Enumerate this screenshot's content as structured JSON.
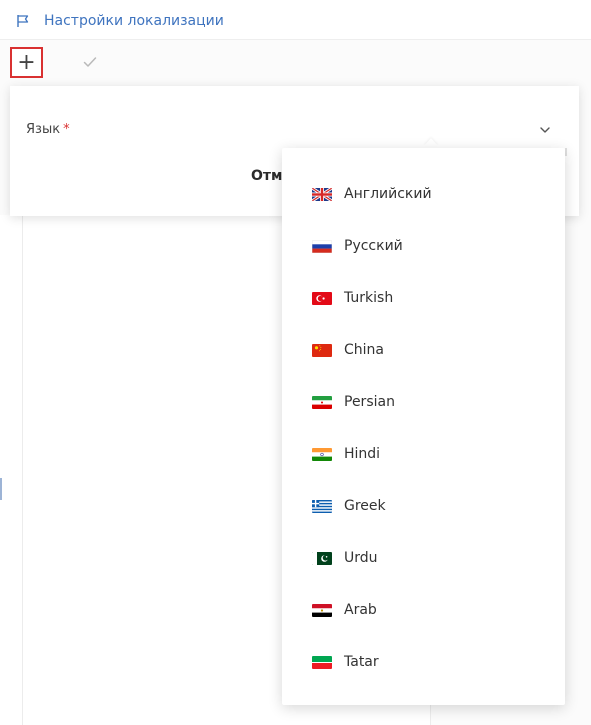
{
  "header": {
    "title": "Настройки локализации",
    "flag_icon": "flag-outline-icon",
    "accent_color": "#3f74bf"
  },
  "toolbar": {
    "add_label": "+",
    "add_icon": "plus-icon",
    "check_icon": "checkmark-icon",
    "highlight_color": "#d93131"
  },
  "form": {
    "language_label": "Язык",
    "required_marker": "*",
    "cancel_label": "Отм",
    "select_icon": "chevron-down-icon"
  },
  "dropdown": {
    "options": [
      {
        "label": "Английский",
        "flag": "uk-flag-icon"
      },
      {
        "label": "Русский",
        "flag": "russia-flag-icon"
      },
      {
        "label": "Turkish",
        "flag": "turkey-flag-icon"
      },
      {
        "label": "China",
        "flag": "china-flag-icon"
      },
      {
        "label": "Persian",
        "flag": "iran-flag-icon"
      },
      {
        "label": "Hindi",
        "flag": "india-flag-icon"
      },
      {
        "label": "Greek",
        "flag": "greece-flag-icon"
      },
      {
        "label": "Urdu",
        "flag": "pakistan-flag-icon"
      },
      {
        "label": "Arab",
        "flag": "egypt-flag-icon"
      },
      {
        "label": "Tatar",
        "flag": "tatarstan-flag-icon"
      }
    ]
  }
}
